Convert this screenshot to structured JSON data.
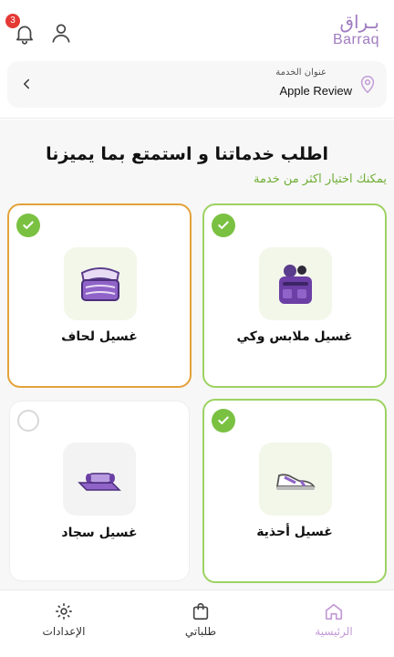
{
  "header": {
    "logo_ar": "بـراق",
    "logo_en": "Barraq",
    "notification_count": "3",
    "colors": {
      "brand": "#a07cc0",
      "badge": "#e53935"
    }
  },
  "address": {
    "label": "عنوان الخدمة",
    "value": "Apple Review"
  },
  "main": {
    "title": "اطلب خدماتنا و استمتع بما يميزنا",
    "subtitle": "يمكنك اختيار اكثر من خدمة",
    "services": [
      {
        "label": "غسيل ملابس وكي",
        "selected": true,
        "icon": "clothes-bag-icon"
      },
      {
        "label": "غسيل لحاف",
        "selected": true,
        "icon": "blanket-icon"
      },
      {
        "label": "غسيل أحذية",
        "selected": true,
        "icon": "shoe-icon"
      },
      {
        "label": "غسيل سجاد",
        "selected": false,
        "icon": "carpet-icon"
      }
    ]
  },
  "nav": {
    "home": "الرئيسية",
    "orders": "طلباتي",
    "settings": "الإعدادات"
  }
}
